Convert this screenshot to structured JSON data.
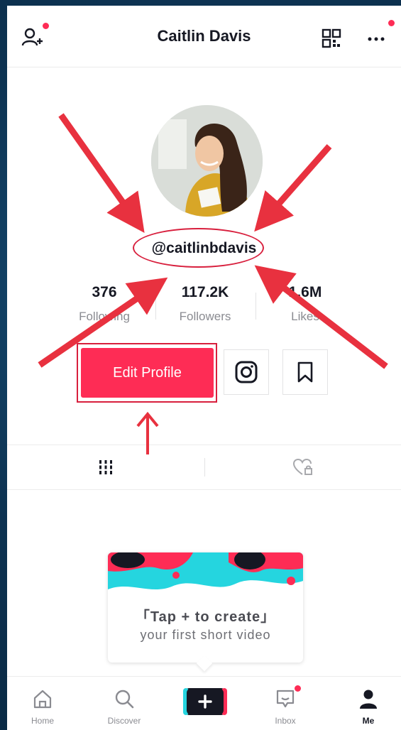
{
  "header": {
    "title": "Caitlin Davis",
    "add_friend_icon": "add-user-icon",
    "qr_icon": "qr-code-icon",
    "more_icon": "more-dots-icon"
  },
  "profile": {
    "handle": "@caitlinbdavis",
    "stats": [
      {
        "value": "376",
        "label": "Following"
      },
      {
        "value": "117.2K",
        "label": "Followers"
      },
      {
        "value": "1.6M",
        "label": "Likes"
      }
    ],
    "edit_label": "Edit Profile",
    "instagram_icon": "instagram-icon",
    "bookmark_icon": "bookmark-icon"
  },
  "tabs": [
    {
      "icon": "grid-icon",
      "active": true
    },
    {
      "icon": "liked-locked-icon",
      "active": false
    }
  ],
  "create_card": {
    "line1": "「Tap + to create」",
    "line2": "your first short video"
  },
  "nav": {
    "items": [
      {
        "label": "Home",
        "icon": "home-icon"
      },
      {
        "label": "Discover",
        "icon": "search-icon"
      },
      {
        "label": "",
        "icon": "plus-icon"
      },
      {
        "label": "Inbox",
        "icon": "inbox-icon"
      },
      {
        "label": "Me",
        "icon": "person-icon"
      }
    ]
  },
  "colors": {
    "accent": "#fe2c55",
    "annotation": "#e8313f",
    "text": "#161823",
    "muted": "#8a8b91"
  }
}
